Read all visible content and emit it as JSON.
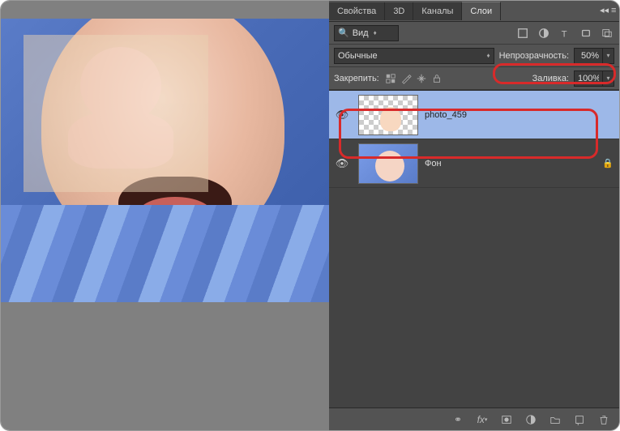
{
  "tabs": {
    "properties": "Свойства",
    "threed": "3D",
    "channels": "Каналы",
    "layers": "Слои"
  },
  "filter": {
    "kind": "Вид"
  },
  "blend": {
    "mode": "Обычные",
    "opacity_label": "Непрозрачность:",
    "opacity_value": "50%"
  },
  "lock": {
    "label": "Закрепить:",
    "fill_label": "Заливка:",
    "fill_value": "100%"
  },
  "layers": [
    {
      "name": "photo_459",
      "locked": false,
      "selected": true
    },
    {
      "name": "Фон",
      "locked": true,
      "selected": false
    }
  ]
}
